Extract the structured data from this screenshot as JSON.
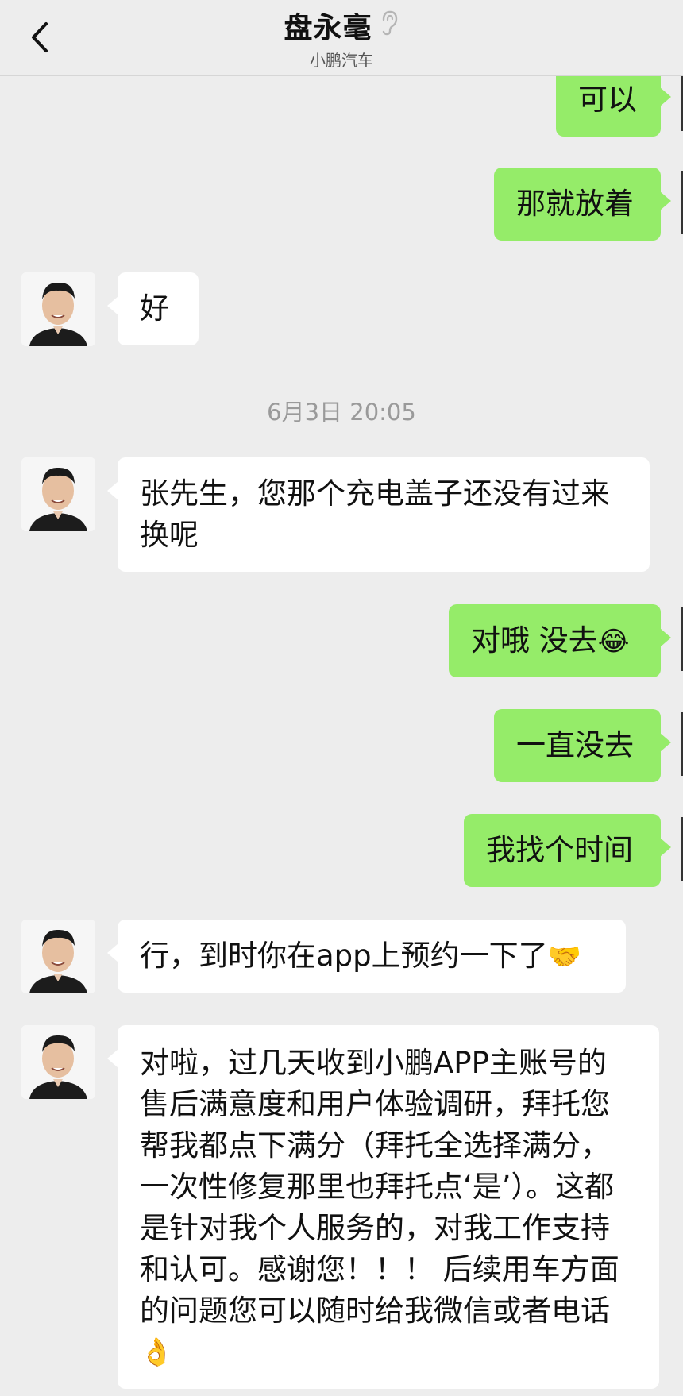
{
  "header": {
    "title": "盘永毫",
    "subtitle": "小鹏汽车",
    "back_icon": "chevron-left-icon",
    "ear_icon": "ear-icon"
  },
  "messages": {
    "m1": "可以",
    "m2": "那就放着",
    "m3": "好",
    "time1": "6月3日 20:05",
    "m4_line1": "张先生，您那个充电盖子还没有过来",
    "m4_line2": "换呢",
    "m5": "对哦 没去",
    "m6": "一直没去",
    "m7": "我找个时间",
    "m8": "行，到时你在app上预约一下了",
    "m9_line1": "对啦，过几天收到小鹏APP主账号的",
    "m9_line2": "售后满意度和用户体验调研，拜托您",
    "m9_line3": "帮我都点下满分（拜托全选择满分，",
    "m9_line4": "一次性修复那里也拜托点‘是’）。这都",
    "m9_line5": "是针对我个人服务的，对我工作支持",
    "m9_line6": "和认可。感谢您！！！ 后续用车方面",
    "m9_line7": "的问题您可以随时给我微信或者电话"
  },
  "emojis": {
    "laugh_cry": "😂",
    "handshake": "🤝",
    "ok_hand": "👌"
  },
  "colors": {
    "outgoing_bubble": "#95ec69",
    "incoming_bubble": "#ffffff",
    "background": "#ededed"
  }
}
